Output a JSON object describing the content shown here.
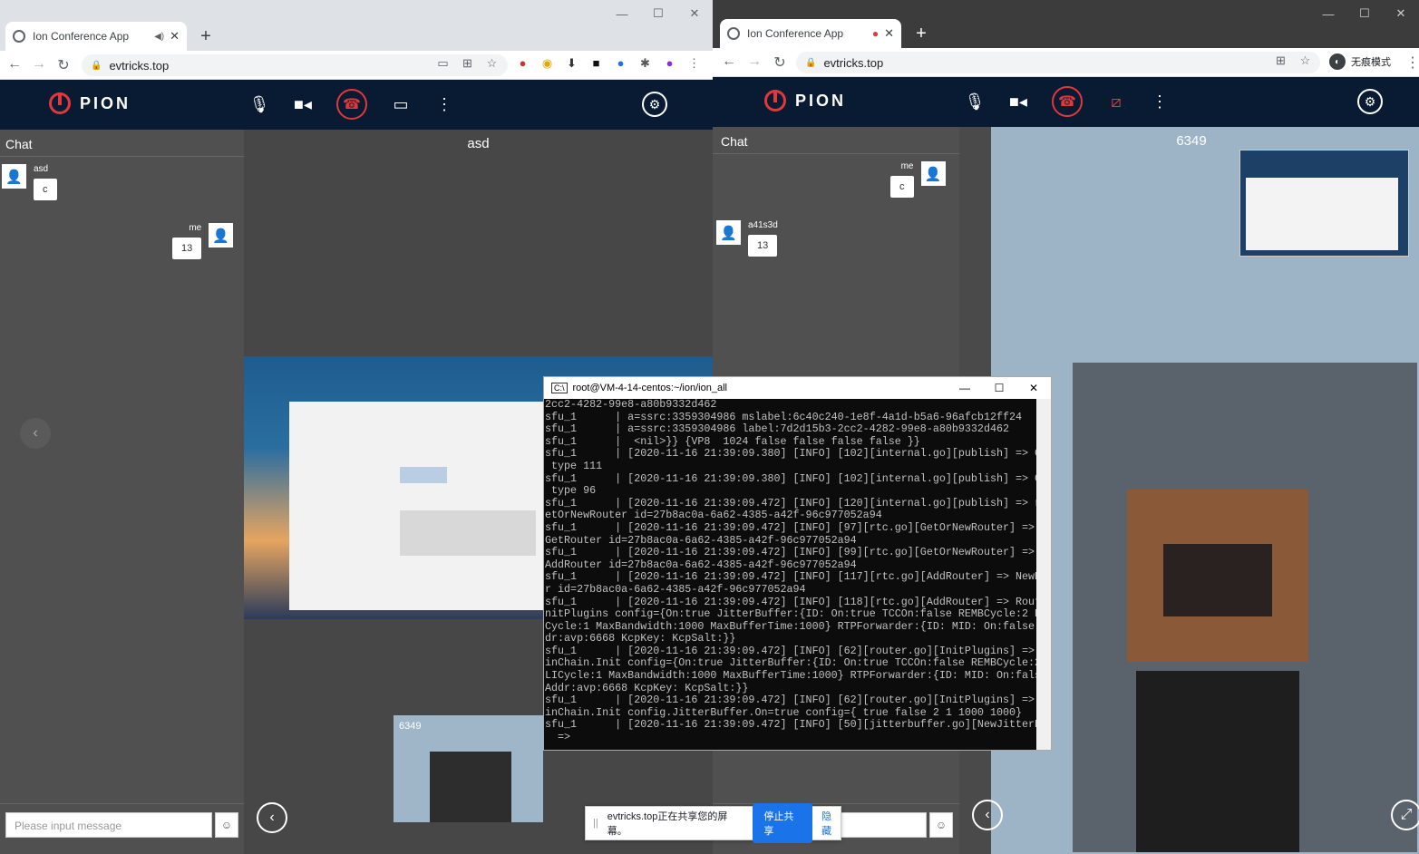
{
  "left_window": {
    "tab_title": "Ion Conference App",
    "url": "evtricks.top",
    "app": {
      "brand": "PION",
      "chat": {
        "title": "Chat",
        "messages": [
          {
            "sender": "asd",
            "text": "c",
            "side": "left"
          },
          {
            "sender": "me",
            "text": "13",
            "side": "right"
          }
        ],
        "input_placeholder": "Please input message"
      },
      "stage_label": "asd",
      "thumb_label": "6349"
    }
  },
  "right_window": {
    "tab_title": "Ion Conference App",
    "url": "evtricks.top",
    "incognito_label": "无痕模式",
    "app": {
      "brand": "PION",
      "chat": {
        "title": "Chat",
        "messages": [
          {
            "sender": "me",
            "text": "c",
            "side": "right"
          },
          {
            "sender": "a41s3d",
            "text": "13",
            "side": "left"
          }
        ]
      },
      "stage_label": "6349"
    }
  },
  "terminal": {
    "title": "root@VM-4-14-centos:~/ion/ion_all",
    "lines": [
      "2cc2-4282-99e8-a80b9332d462",
      "sfu_1      | a=ssrc:3359304986 mslabel:6c40c240-1e8f-4a1d-b5a6-96afcb12ff24",
      "sfu_1      | a=ssrc:3359304986 label:7d2d15b3-2cc2-4282-99e8-a80b9332d462",
      "sfu_1      |  <nil>}} {VP8  1024 false false false false }}",
      "sfu_1      | [2020-11-16 21:39:09.380] [INFO] [102][internal.go][publish] => Codec",
      " type 111",
      "sfu_1      | [2020-11-16 21:39:09.380] [INFO] [102][internal.go][publish] => Codec",
      " type 96",
      "sfu_1      | [2020-11-16 21:39:09.472] [INFO] [120][internal.go][publish] => rtc.G",
      "etOrNewRouter id=27b8ac0a-6a62-4385-a42f-96c977052a94",
      "sfu_1      | [2020-11-16 21:39:09.472] [INFO] [97][rtc.go][GetOrNewRouter] => rtc.",
      "GetRouter id=27b8ac0a-6a62-4385-a42f-96c977052a94",
      "sfu_1      | [2020-11-16 21:39:09.472] [INFO] [99][rtc.go][GetOrNewRouter] => rtc.",
      "AddRouter id=27b8ac0a-6a62-4385-a42f-96c977052a94",
      "sfu_1      | [2020-11-16 21:39:09.472] [INFO] [117][rtc.go][AddRouter] => NewRoute",
      "r id=27b8ac0a-6a62-4385-a42f-96c977052a94",
      "sfu_1      | [2020-11-16 21:39:09.472] [INFO] [118][rtc.go][AddRouter] => Router.I",
      "nitPlugins config={On:true JitterBuffer:{ID: On:true TCCOn:false REMBCycle:2 PLI",
      "Cycle:1 MaxBandwidth:1000 MaxBufferTime:1000} RTPForwarder:{ID: MID: On:false Ad",
      "dr:avp:6668 KcpKey: KcpSalt:}}",
      "sfu_1      | [2020-11-16 21:39:09.472] [INFO] [62][router.go][InitPlugins] => Plug",
      "inChain.Init config={On:true JitterBuffer:{ID: On:true TCCOn:false REMBCycle:2 P",
      "LICycle:1 MaxBandwidth:1000 MaxBufferTime:1000} RTPForwarder:{ID: MID: On:false",
      "Addr:avp:6668 KcpKey: KcpSalt:}}",
      "sfu_1      | [2020-11-16 21:39:09.472] [INFO] [62][router.go][InitPlugins] => Plug",
      "inChain.Init config.JitterBuffer.On=true config={ true false 2 1 1000 1000}",
      "sfu_1      | [2020-11-16 21:39:09.472] [INFO] [50][jitterbuffer.go][NewJitterBuffe",
      "  =>"
    ]
  },
  "share_bar": {
    "message": "evtricks.top正在共享您的屏幕。",
    "stop_label": "停止共享",
    "hide_label": "隐藏"
  },
  "colors": {
    "appbar": "#081b33",
    "accent_red": "#e0383b",
    "chat_bg": "#505050",
    "stage_bg": "#474747"
  }
}
